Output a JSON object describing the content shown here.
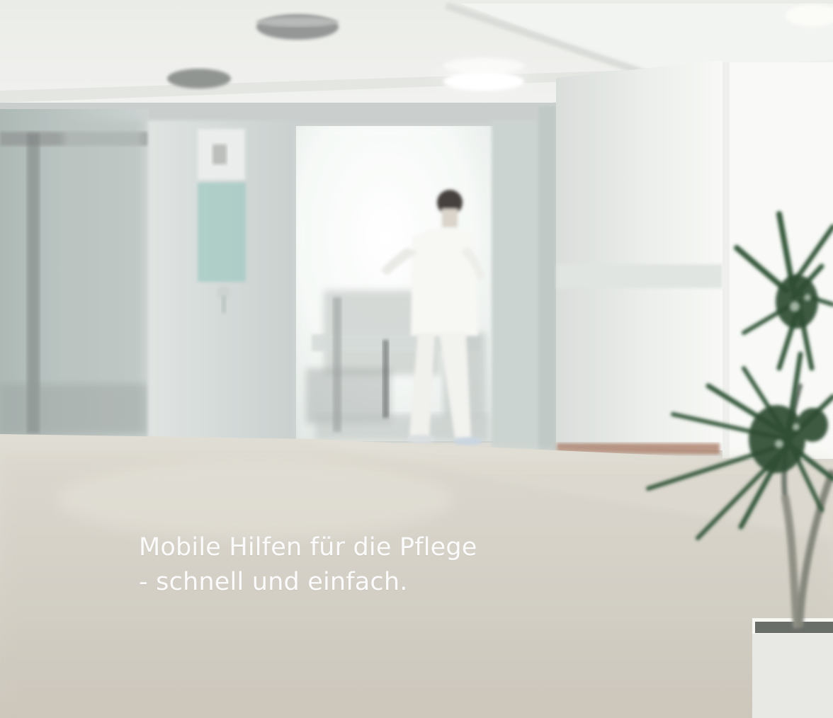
{
  "hero": {
    "headline": "Mobile Hilfen für die Pflege",
    "subheadline": "- schnell und einfach."
  },
  "colors": {
    "caption_text": "#fbfbfb",
    "floor": "#d6d3c8",
    "wall": "#ecefea",
    "plant_green": "#264c2f"
  },
  "icons": {
    "photo": "hospital-corridor-photo"
  }
}
